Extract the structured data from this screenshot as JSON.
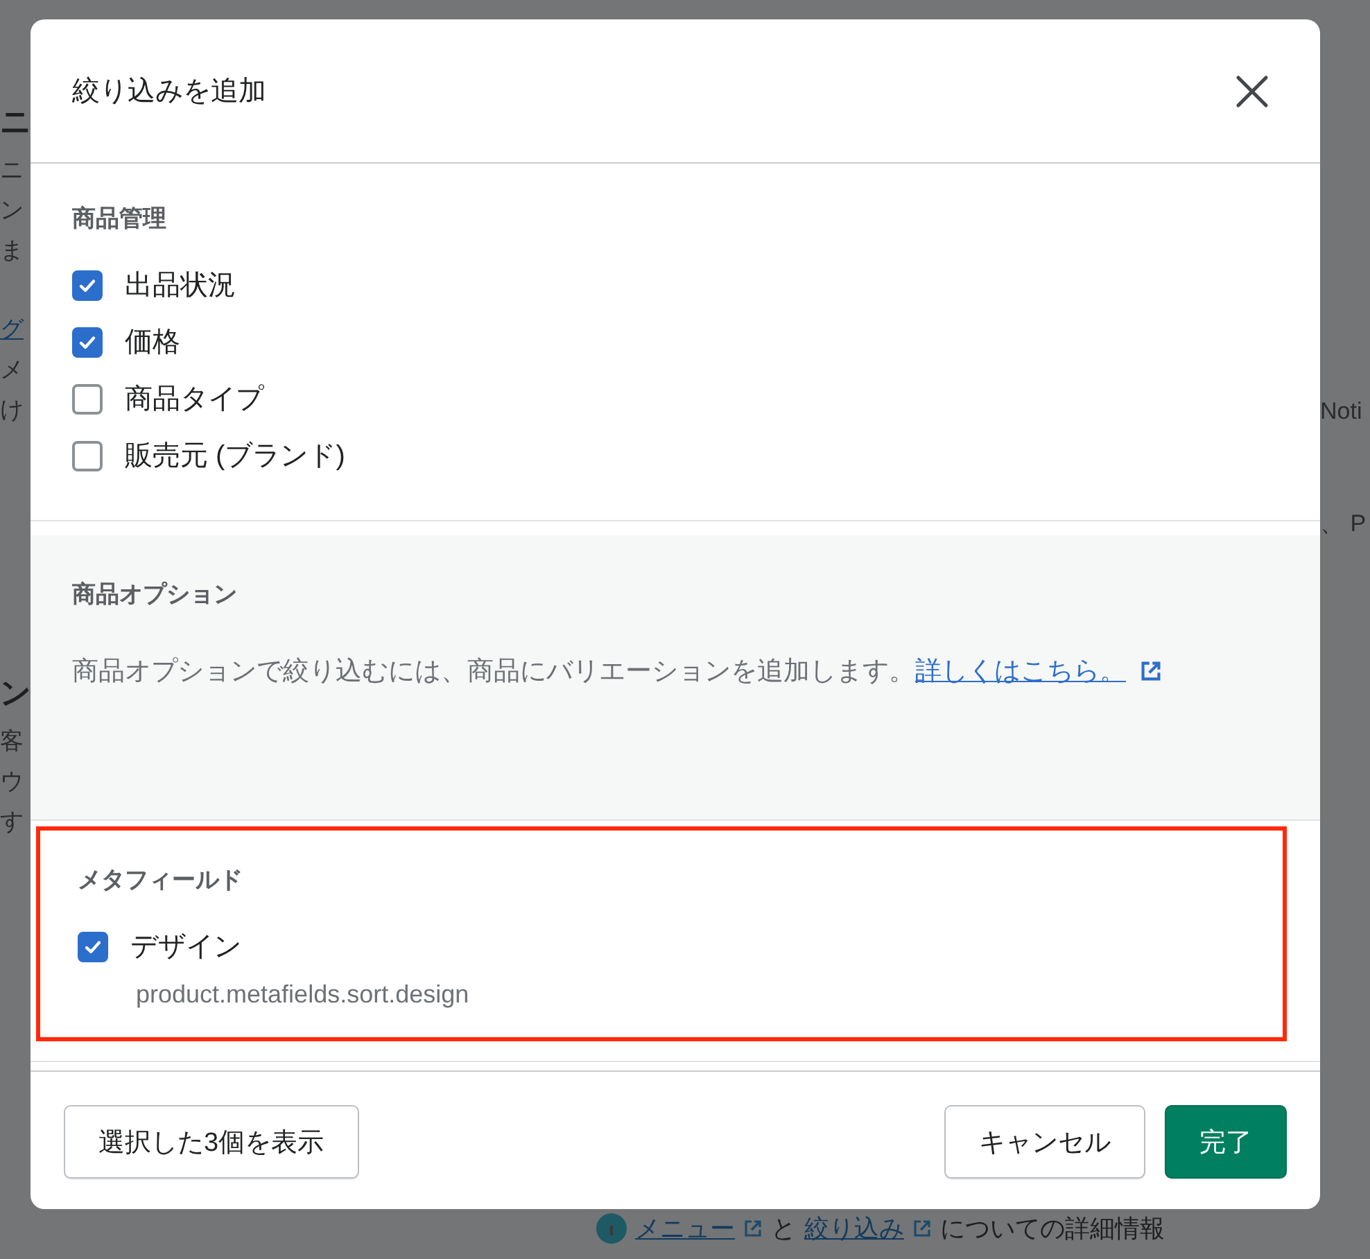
{
  "backdrop": {
    "left_lines": [
      {
        "kind": "heading",
        "text": "ニ"
      },
      {
        "kind": "text",
        "text": "ニ"
      },
      {
        "kind": "text",
        "text": "ン"
      },
      {
        "kind": "text",
        "text": "ま"
      },
      {
        "kind": "link",
        "text": "グ"
      },
      {
        "kind": "text",
        "text": "メ"
      },
      {
        "kind": "text",
        "text": "け"
      },
      {
        "kind": "heading",
        "text": "ン"
      },
      {
        "kind": "text",
        "text": "客"
      },
      {
        "kind": "text",
        "text": "ウ"
      },
      {
        "kind": "text",
        "text": "す"
      }
    ],
    "right_lines": [
      "Noti",
      "、 P"
    ],
    "footer": {
      "link_1": "メニュー",
      "joiner": "と",
      "link_2": "絞り込み",
      "tail": "についての詳細情報"
    }
  },
  "dialog": {
    "title": "絞り込みを追加",
    "sections": [
      {
        "kind": "checklist",
        "heading": "商品管理",
        "highlighted": false,
        "items": [
          {
            "label": "出品状況",
            "checked": true
          },
          {
            "label": "価格",
            "checked": true
          },
          {
            "label": "商品タイプ",
            "checked": false
          },
          {
            "label": "販売元 (ブランド)",
            "checked": false
          }
        ]
      },
      {
        "kind": "note",
        "heading": "商品オプション",
        "text": "商品オプションで絞り込むには、商品にバリエーションを追加します。",
        "link": "詳しくはこちら。",
        "highlighted": false
      },
      {
        "kind": "checklist",
        "heading": "メタフィールド",
        "highlighted": true,
        "items": [
          {
            "label": "デザイン",
            "checked": true,
            "detail": "product.metafields.sort.design"
          }
        ]
      }
    ],
    "buttons": {
      "show_selected": "選択した3個を表示",
      "cancel": "キャンセル",
      "done": "完了"
    }
  }
}
